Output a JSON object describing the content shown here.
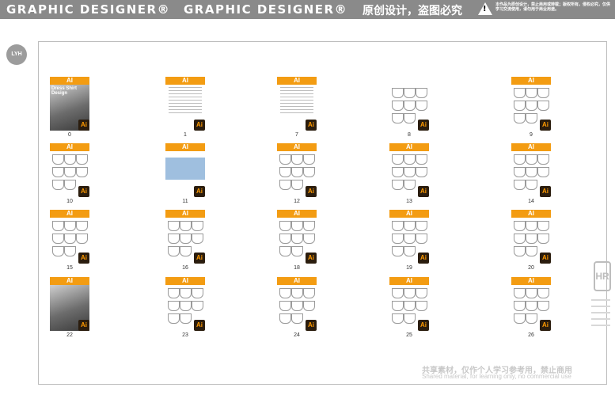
{
  "banner": {
    "title_left": "GRAPHIC DESIGNER®",
    "title_mid": "GRAPHIC DESIGNER®",
    "title_cn": "原创设计，盗图必究",
    "warning_symbol": "!",
    "note": "本作品为原创设计，禁止商用或转载；版权所有，侵权必究，仅供学习交流使用，请勿用于商业用途。"
  },
  "logo": {
    "text": "LYH"
  },
  "side_brand": {
    "text": "HR"
  },
  "thumbs": [
    {
      "num": "0",
      "ai": "Ai",
      "tag": "AI",
      "kind": "cover",
      "title": "Dress Shirt Design"
    },
    {
      "num": "1",
      "ai": "Ai",
      "tag": "AI",
      "kind": "text"
    },
    {
      "num": "7",
      "ai": "Ai",
      "tag": "AI",
      "kind": "text"
    },
    {
      "num": "8",
      "ai": "Ai",
      "tag": "",
      "kind": "shirts"
    },
    {
      "num": "9",
      "ai": "Ai",
      "tag": "AI",
      "kind": "shirts"
    },
    {
      "num": "10",
      "ai": "Ai",
      "tag": "AI",
      "kind": "shirts"
    },
    {
      "num": "11",
      "ai": "Ai",
      "tag": "AI",
      "kind": "photo-blue"
    },
    {
      "num": "12",
      "ai": "Ai",
      "tag": "AI",
      "kind": "shirts"
    },
    {
      "num": "13",
      "ai": "Ai",
      "tag": "AI",
      "kind": "shirts"
    },
    {
      "num": "14",
      "ai": "Ai",
      "tag": "AI",
      "kind": "shirts"
    },
    {
      "num": "15",
      "ai": "Ai",
      "tag": "AI",
      "kind": "shirts"
    },
    {
      "num": "16",
      "ai": "Ai",
      "tag": "AI",
      "kind": "shirts"
    },
    {
      "num": "18",
      "ai": "Ai",
      "tag": "AI",
      "kind": "shirts"
    },
    {
      "num": "19",
      "ai": "Ai",
      "tag": "AI",
      "kind": "shirts"
    },
    {
      "num": "20",
      "ai": "Ai",
      "tag": "AI",
      "kind": "shirts"
    },
    {
      "num": "22",
      "ai": "Ai",
      "tag": "AI",
      "kind": "photo"
    },
    {
      "num": "23",
      "ai": "Ai",
      "tag": "AI",
      "kind": "shirts"
    },
    {
      "num": "24",
      "ai": "Ai",
      "tag": "AI",
      "kind": "shirts"
    },
    {
      "num": "25",
      "ai": "Ai",
      "tag": "AI",
      "kind": "shirts"
    },
    {
      "num": "26",
      "ai": "Ai",
      "tag": "AI",
      "kind": "shirts"
    }
  ],
  "footer": {
    "cn": "共享素材，仅作个人学习参考用，禁止商用",
    "en": "Shared material, for learning only, no commercial use"
  },
  "colors": {
    "banner": "#8a8a8a",
    "tag": "#f39c12",
    "ai_bg": "#2b1d0e",
    "ai_fg": "#ff9a00"
  }
}
